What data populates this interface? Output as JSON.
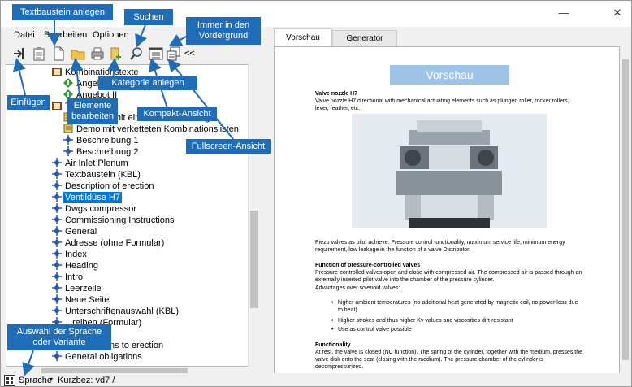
{
  "window": {
    "minimize_icon": "minimize-icon",
    "close_icon": "close-icon"
  },
  "menu": {
    "items": [
      "Datei",
      "Bearbeiten",
      "Optionen"
    ]
  },
  "toolbar": {
    "collapse_label": "<<"
  },
  "tree": {
    "rows": [
      {
        "label": "Kombinationstexte",
        "icon": "folder-book-icon",
        "indent": 1
      },
      {
        "label": "Angebot I",
        "icon": "green-diamond-icon",
        "indent": 2
      },
      {
        "label": "Angebot II",
        "icon": "green-diamond-icon",
        "indent": 2
      },
      {
        "label": "Textbaus...",
        "icon": "folder-book-icon",
        "indent": 1
      },
      {
        "label": "Baustein mit einfacher  Verkettung",
        "icon": "yellow-doc-icon",
        "indent": 2
      },
      {
        "label": "Demo mit verketteten Kombinationslisten",
        "icon": "yellow-doc-icon",
        "indent": 2
      },
      {
        "label": "Beschreibung 1",
        "icon": "blue-node-icon",
        "indent": 2
      },
      {
        "label": "Beschreibung 2",
        "icon": "blue-node-icon",
        "indent": 2
      },
      {
        "label": "Air Inlet Plenum",
        "icon": "blue-node-icon",
        "indent": 1
      },
      {
        "label": "Textbaustein (KBL)",
        "icon": "blue-node-icon",
        "indent": 1
      },
      {
        "label": "Description of erection",
        "icon": "blue-node-icon",
        "indent": 1
      },
      {
        "label": "Ventildüse H7",
        "icon": "blue-node-icon",
        "indent": 1,
        "selected": true
      },
      {
        "label": "Dwgs compressor",
        "icon": "blue-node-icon",
        "indent": 1
      },
      {
        "label": "Commissioning Instructions",
        "icon": "blue-node-icon",
        "indent": 1
      },
      {
        "label": "General",
        "icon": "blue-node-icon",
        "indent": 1
      },
      {
        "label": "Adresse (ohne Formular)",
        "icon": "blue-node-icon",
        "indent": 1
      },
      {
        "label": "Index",
        "icon": "blue-node-icon",
        "indent": 1
      },
      {
        "label": "Heading",
        "icon": "blue-node-icon",
        "indent": 1
      },
      {
        "label": "Intro",
        "icon": "blue-node-icon",
        "indent": 1
      },
      {
        "label": "Leerzeile",
        "icon": "blue-node-icon",
        "indent": 1
      },
      {
        "label": "Neue Seite",
        "icon": "blue-node-icon",
        "indent": 1
      },
      {
        "label": "Unterschriftenauswahl (KBL)",
        "icon": "blue-node-icon",
        "indent": 1
      },
      {
        "label": "...reiben (Formular)",
        "icon": "blue-node-icon",
        "indent": 1
      },
      {
        "label": "...area",
        "icon": "blue-node-icon",
        "indent": 1
      },
      {
        "label": "Preconditions to erection",
        "icon": "blue-node-icon",
        "indent": 1
      },
      {
        "label": "General obligations",
        "icon": "blue-node-icon",
        "indent": 1
      }
    ]
  },
  "tabs": [
    "Vorschau",
    "Generator"
  ],
  "preview": {
    "header": "Vorschau",
    "title": "Valve nozzle H7",
    "intro": "Valve nozzle H7 directional with mechanical actuating elements such as plunger, roller, rocker rollers, lever, feather, etc.",
    "para1": "Piezo valves as pilot achieve: Pressure control functionality, maximum service life, minimum energy requirement, low leakage in the function of a valve Distributor.",
    "section1_title": "Function of pressure-controlled valves",
    "section1_text": "Pressure-controlled valves open and close with compressed air. The compressed air is passed through an externally inserted pilot valve into the chamber of the pressure cylinder.",
    "section1_adv": "Advantages over solenoid valves:",
    "bullets": [
      "higher ambient temperatures (no additional heat generated by magnetic coil, no power loss due to heat)",
      "Higher strokes and thus higher Kv values and viscosities dirt-resistant",
      "Use as control valve possible"
    ],
    "section2_title": "Functionality",
    "section2_text": "At rest, the valve is closed (NC function). The spring of the cylinder, together with the medium, presses the valve disk onto the seat (closing with the medium). The pressure chamber of the cylinder is decompressurized."
  },
  "status": {
    "language_label": "Sprache",
    "shortcode": "Kurzbez: vd7 /"
  },
  "callouts": {
    "textbaustein": "Textbaustein anlegen",
    "suchen": "Suchen",
    "vordergrund": "Immer in den Vordergrund",
    "kategorie": "Kategorie anlegen",
    "einfuegen": "Einfügen",
    "elemente": "Elemente bearbeiten",
    "kompakt": "Kompakt-Ansicht",
    "fullscreen": "Fullscreen-Ansicht",
    "sprache": "Auswahl der Sprache oder Variante"
  },
  "colors": {
    "callout": "#1f6cb8",
    "selection": "#0078d7",
    "preview_header": "#9dc3e6"
  }
}
